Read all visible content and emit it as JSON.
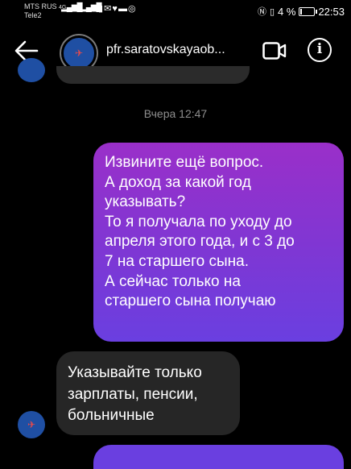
{
  "status_bar": {
    "carrier1": "MTS RUS",
    "carrier1_net": "4G",
    "carrier2": "Tele2",
    "battery": "4 %",
    "time": "22:53"
  },
  "header": {
    "contact_name": "pfr.saratovskayaob..."
  },
  "chat": {
    "date_separator": "Вчера 12:47",
    "outgoing_lines": [
      "Извините ещё вопрос.",
      "А доход за какой год",
      "указывать?",
      "То я получала по уходу до",
      "апреля этого года, и с 3 до",
      "7 на старшего сына.",
      "А сейчас только на",
      "старшего сына получаю"
    ],
    "incoming_lines": [
      "Указывайте только",
      "зарплаты, пенсии,",
      "больничные"
    ]
  },
  "colors": {
    "outgoing_top": "#9a2fc9",
    "outgoing_bottom": "#6a3fe0",
    "incoming": "#262626",
    "avatar": "#1f4fa3"
  }
}
